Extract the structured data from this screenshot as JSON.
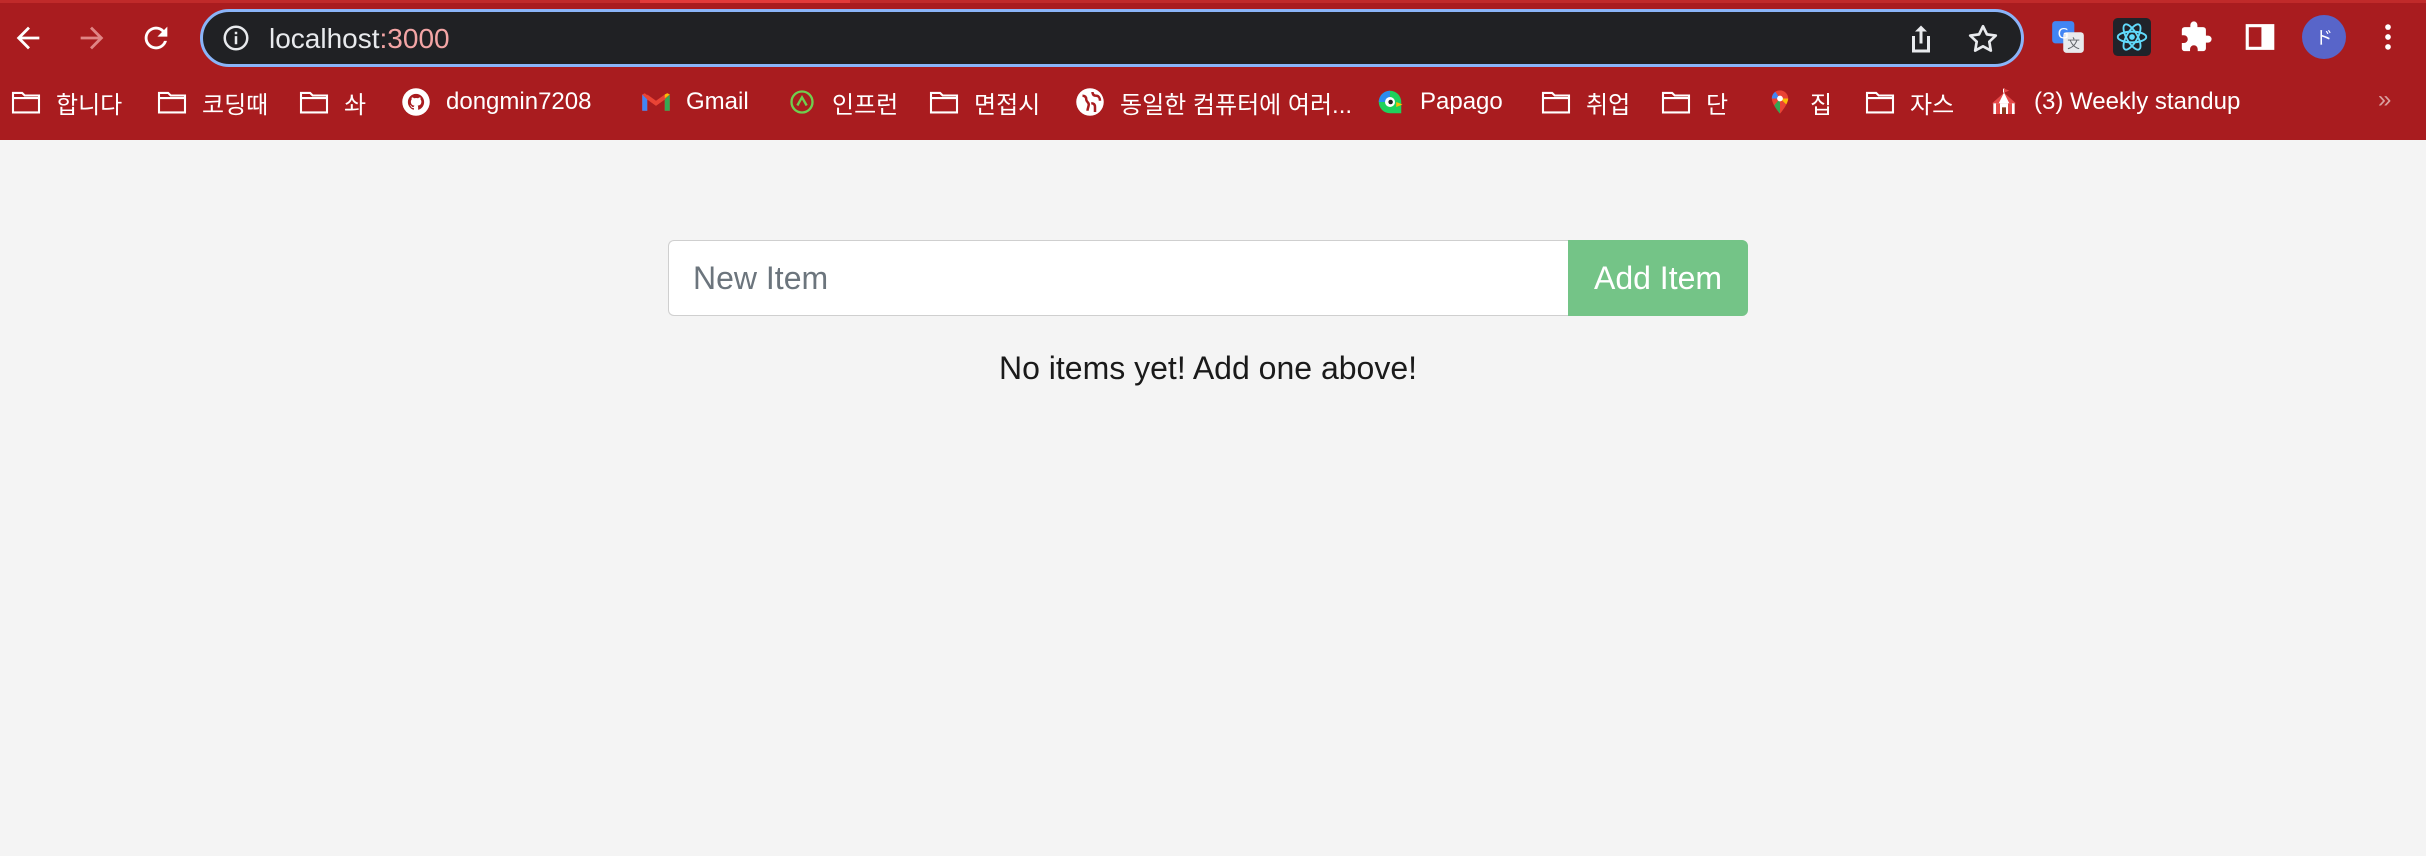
{
  "browser": {
    "url_host": "localhost",
    "url_port": ":3000",
    "avatar_initial": "ド",
    "more_bookmarks": "»",
    "bookmarks": [
      {
        "label": "합니다",
        "icon": "folder-icon"
      },
      {
        "label": "코딩때",
        "icon": "folder-icon"
      },
      {
        "label": "솨",
        "icon": "folder-icon"
      },
      {
        "label": "dongmin7208",
        "icon": "github-icon"
      },
      {
        "label": "Gmail",
        "icon": "gmail-icon"
      },
      {
        "label": "인프런",
        "icon": "inflearn-icon"
      },
      {
        "label": "면접시",
        "icon": "folder-icon"
      },
      {
        "label": "동일한 컴퓨터에 여러...",
        "icon": "globe-icon"
      },
      {
        "label": "Papago",
        "icon": "papago-icon"
      },
      {
        "label": "취업",
        "icon": "folder-icon"
      },
      {
        "label": "단",
        "icon": "folder-icon"
      },
      {
        "label": "집",
        "icon": "maps-pin-icon"
      },
      {
        "label": "자스",
        "icon": "folder-icon"
      },
      {
        "label": "(3) Weekly standup",
        "icon": "circus-tent-icon"
      }
    ]
  },
  "app": {
    "input_placeholder": "New Item",
    "input_value": "",
    "add_button_label": "Add Item",
    "empty_message": "No items yet! Add one above!"
  },
  "colors": {
    "toolbar": "#a91c1f",
    "omnibox": "#202124",
    "add_button": "#74c487",
    "page_background": "#f4f4f4"
  }
}
